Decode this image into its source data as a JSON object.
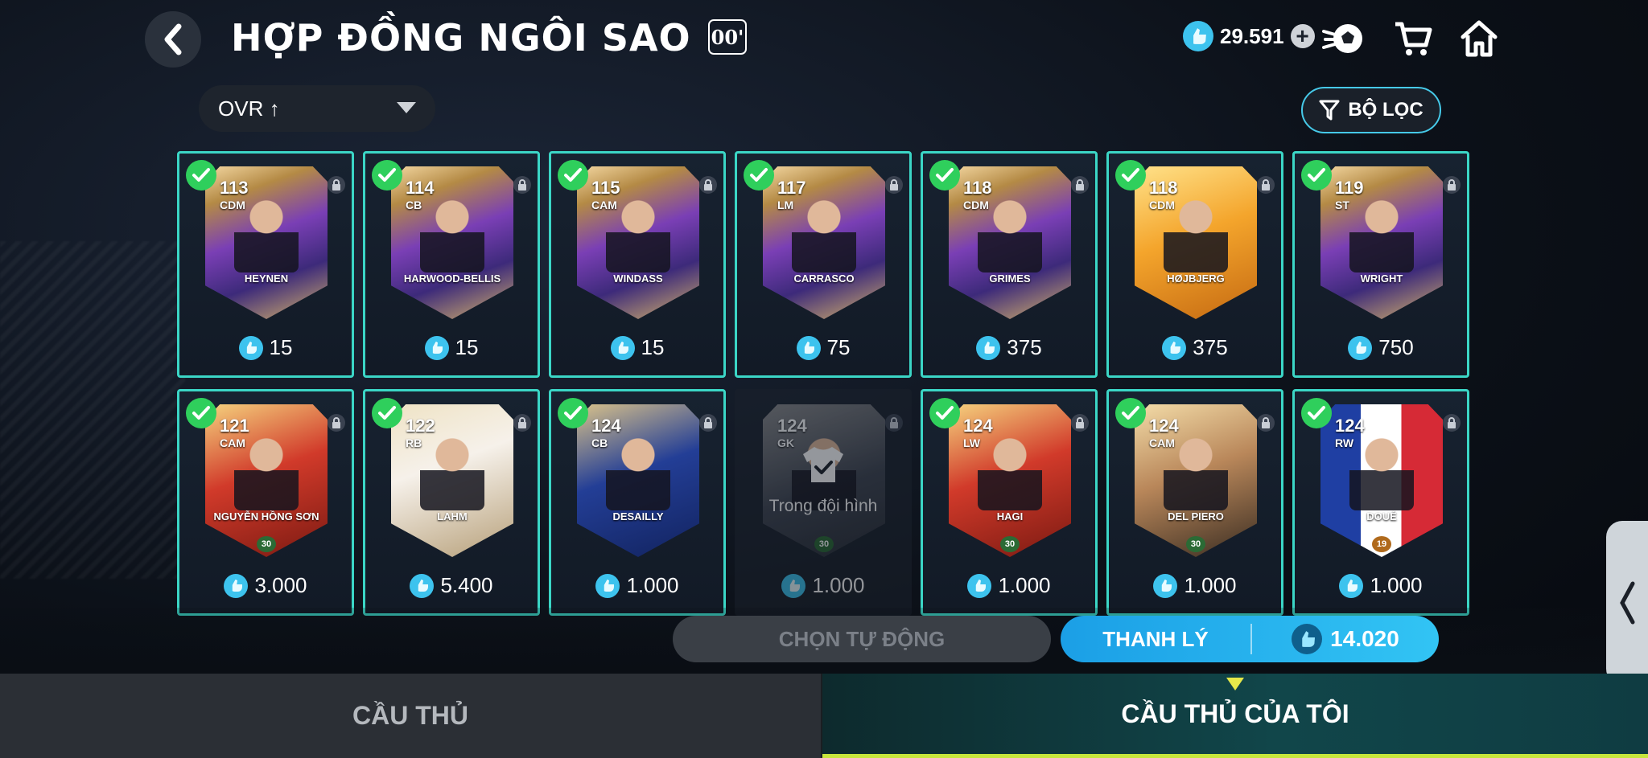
{
  "header": {
    "title": "HỢP ĐỒNG NGÔI SAO",
    "badge": "00'",
    "currency_value": "29.591"
  },
  "sort": {
    "label": "OVR ↑"
  },
  "filter": {
    "label": "BỘ LỌC"
  },
  "players": [
    {
      "ovr": "113",
      "pos": "CDM",
      "name": "HEYNEN",
      "price": "15",
      "card": "purple"
    },
    {
      "ovr": "114",
      "pos": "CB",
      "name": "HARWOOD-BELLIS",
      "price": "15",
      "card": "purple"
    },
    {
      "ovr": "115",
      "pos": "CAM",
      "name": "WINDASS",
      "price": "15",
      "card": "purple"
    },
    {
      "ovr": "117",
      "pos": "LM",
      "name": "CARRASCO",
      "price": "75",
      "card": "purple"
    },
    {
      "ovr": "118",
      "pos": "CDM",
      "name": "GRIMES",
      "price": "375",
      "card": "purple"
    },
    {
      "ovr": "118",
      "pos": "CDM",
      "name": "HØJBJERG",
      "price": "375",
      "card": "orange"
    },
    {
      "ovr": "119",
      "pos": "ST",
      "name": "WRIGHT",
      "price": "750",
      "card": "purple"
    },
    {
      "ovr": "121",
      "pos": "CAM",
      "name": "NGUYỄN HỒNG SƠN",
      "price": "3.000",
      "card": "red",
      "level": "30"
    },
    {
      "ovr": "122",
      "pos": "RB",
      "name": "LAHM",
      "price": "5.400",
      "card": "white"
    },
    {
      "ovr": "124",
      "pos": "CB",
      "name": "DESAILLY",
      "price": "1.000",
      "card": "blue"
    },
    {
      "ovr": "124",
      "pos": "GK",
      "name": "",
      "price": "1.000",
      "card": "grey",
      "level": "30",
      "in_squad": "Trong đội hình"
    },
    {
      "ovr": "124",
      "pos": "LW",
      "name": "HAGI",
      "price": "1.000",
      "card": "red",
      "level": "30"
    },
    {
      "ovr": "124",
      "pos": "CAM",
      "name": "DEL PIERO",
      "price": "1.000",
      "card": "bronze",
      "level": "30"
    },
    {
      "ovr": "124",
      "pos": "RW",
      "name": "DOUÉ",
      "price": "1.000",
      "card": "flag",
      "level": "19"
    }
  ],
  "actions": {
    "auto_label": "CHỌN TỰ ĐỘNG",
    "sell_label": "THANH LÝ",
    "sell_amount": "14.020"
  },
  "tabs": [
    {
      "label": "CẦU THỦ"
    },
    {
      "label": "CẦU THỦ CỦA TÔI"
    }
  ],
  "colors": {
    "accent": "#3bd6c6",
    "check": "#2fcf5c",
    "coin": "#3dc3ee",
    "sell": "#1b9fe6"
  }
}
